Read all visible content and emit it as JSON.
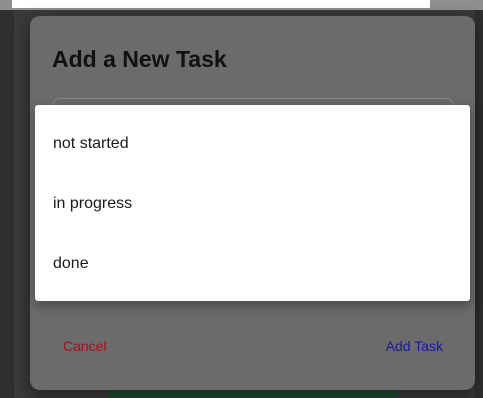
{
  "dialog": {
    "title": "Add a New Task",
    "cancel_label": "Cancel",
    "submit_label": "Add Task",
    "colors": {
      "cancel": "#a21414",
      "submit": "#1a1a9a",
      "dialog_bg": "#6b6b6b"
    }
  },
  "status_menu": {
    "options": [
      {
        "label": "not started"
      },
      {
        "label": "in progress"
      },
      {
        "label": "done"
      }
    ]
  }
}
